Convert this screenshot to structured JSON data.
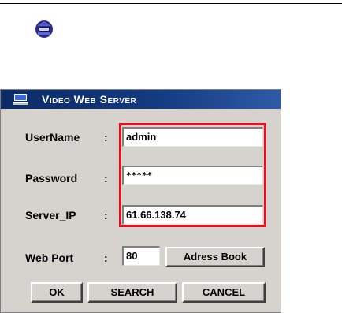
{
  "dialog": {
    "title": "Video Web Server",
    "fields": {
      "username": {
        "label": "UserName",
        "value": "admin"
      },
      "password": {
        "label": "Password",
        "value": "*****"
      },
      "server_ip": {
        "label": "Server_IP",
        "value": "61.66.138.74"
      },
      "web_port": {
        "label": "Web Port",
        "value": "80"
      }
    },
    "colon": ":",
    "buttons": {
      "address_book": "Adress Book",
      "ok": "OK",
      "search": "SEARCH",
      "cancel": "CANCEL"
    }
  },
  "colors": {
    "titlebar": "#143a80",
    "dialog_bg": "#d6d3ce",
    "highlight": "#e3101e"
  }
}
